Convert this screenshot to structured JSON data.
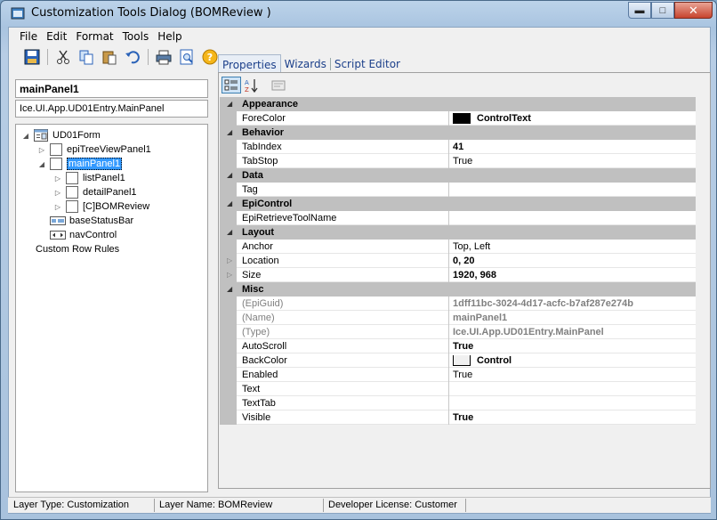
{
  "window": {
    "title": "Customization Tools Dialog  (BOMReview )",
    "minimize": "▬",
    "maximize": "□",
    "close": "✕"
  },
  "menu": [
    "File",
    "Edit",
    "Format",
    "Tools",
    "Help"
  ],
  "toolbar_icons": [
    "save-icon",
    "cut-icon",
    "copy-icon",
    "paste-icon",
    "undo-icon",
    "print-icon",
    "print-preview-icon",
    "help-icon"
  ],
  "left": {
    "header": "mainPanel1",
    "subheader": "Ice.UI.App.UD01Entry.MainPanel",
    "tree": {
      "root": "UD01Form",
      "epiTree": "epiTreeViewPanel1",
      "mainPanel": "mainPanel1",
      "listPanel": "listPanel1",
      "detailPanel": "detailPanel1",
      "bomReview": "[C]BOMReview",
      "status": "baseStatusBar",
      "nav": "navControl",
      "rules": "Custom Row Rules"
    }
  },
  "tabs": [
    "Properties",
    "Wizards",
    "Script Editor"
  ],
  "properties": {
    "appearance": "Appearance",
    "forecolor_name": "ForeColor",
    "forecolor_val": "ControlText",
    "behavior": "Behavior",
    "tabindex_name": "TabIndex",
    "tabindex_val": "41",
    "tabstop_name": "TabStop",
    "tabstop_val": "True",
    "data": "Data",
    "tag_name": "Tag",
    "tag_val": "",
    "epicontrol": "EpiControl",
    "retrieve_name": "EpiRetrieveToolName",
    "retrieve_val": "",
    "layout": "Layout",
    "anchor_name": "Anchor",
    "anchor_val": "Top, Left",
    "location_name": "Location",
    "location_val": "0, 20",
    "size_name": "Size",
    "size_val": "1920, 968",
    "misc": "Misc",
    "guid_name": "(EpiGuid)",
    "guid_val": "1dff11bc-3024-4d17-acfc-b7af287e274b",
    "name_name": "(Name)",
    "name_val": "mainPanel1",
    "type_name": "(Type)",
    "type_val": "Ice.UI.App.UD01Entry.MainPanel",
    "autoscroll_name": "AutoScroll",
    "autoscroll_val": "True",
    "backcolor_name": "BackColor",
    "backcolor_val": "Control",
    "enabled_name": "Enabled",
    "enabled_val": "True",
    "text_name": "Text",
    "text_val": "",
    "texttab_name": "TextTab",
    "texttab_val": "",
    "visible_name": "Visible",
    "visible_val": "True"
  },
  "colors": {
    "controltext": "#000000",
    "control": "#f0f0f0",
    "selection": "#3399ff"
  },
  "status": {
    "layer_type": "Layer Type:  Customization",
    "layer_name": "Layer Name:  BOMReview",
    "license": "Developer License:  Customer"
  }
}
